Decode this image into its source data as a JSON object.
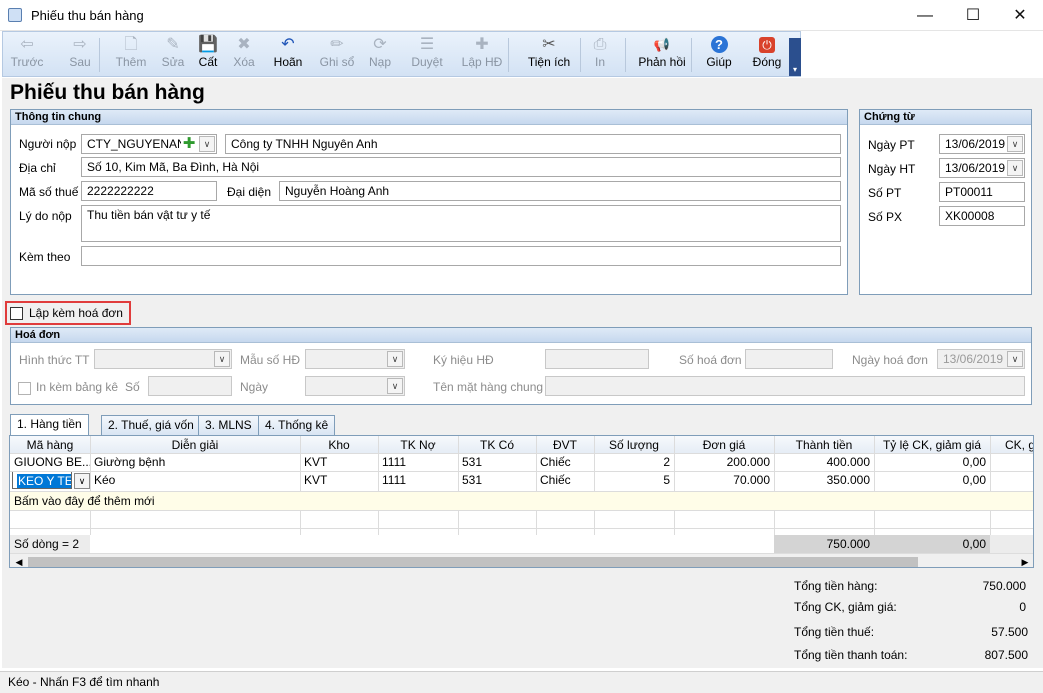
{
  "window": {
    "title": "Phiếu thu bán hàng"
  },
  "toolbar": {
    "items": [
      {
        "label": "Trước",
        "icon": "arrow-left-icon",
        "glyph": "⇦",
        "enabled": false
      },
      {
        "label": "Sau",
        "icon": "arrow-right-icon",
        "glyph": "⇨",
        "enabled": false
      },
      {
        "label": "Thêm",
        "icon": "add-doc-icon",
        "glyph": "🗋",
        "enabled": false
      },
      {
        "label": "Sửa",
        "icon": "edit-doc-icon",
        "glyph": "✎",
        "enabled": false
      },
      {
        "label": "Cất",
        "icon": "save-icon",
        "glyph": "💾",
        "enabled": true
      },
      {
        "label": "Xóa",
        "icon": "delete-doc-icon",
        "glyph": "✖",
        "enabled": false
      },
      {
        "label": "Hoãn",
        "icon": "undo-icon",
        "glyph": "↶",
        "enabled": true
      },
      {
        "label": "Ghi sổ",
        "icon": "pencil-icon",
        "glyph": "✏",
        "enabled": false
      },
      {
        "label": "Nạp",
        "icon": "reload-icon",
        "glyph": "⟳",
        "enabled": false
      },
      {
        "label": "Duyệt",
        "icon": "approve-icon",
        "glyph": "☰",
        "enabled": false
      },
      {
        "label": "Lập HĐ",
        "icon": "invoice-icon",
        "glyph": "✚",
        "enabled": false
      },
      {
        "label": "Tiện ích",
        "icon": "tools-icon",
        "glyph": "✂",
        "enabled": true
      },
      {
        "label": "In",
        "icon": "printer-icon",
        "glyph": "⎙",
        "enabled": false
      },
      {
        "label": "Phản hồi",
        "icon": "megaphone-icon",
        "glyph": "📢",
        "enabled": true
      },
      {
        "label": "Giúp",
        "icon": "help-icon",
        "glyph": "?",
        "enabled": true
      },
      {
        "label": "Đóng",
        "icon": "power-icon",
        "glyph": "⏻",
        "enabled": true
      }
    ]
  },
  "page_title": "Phiếu thu bán hàng",
  "general": {
    "header": "Thông tin chung",
    "payer_label": "Người nộp",
    "payer_code": "CTY_NGUYENAN",
    "payer_name": "Công ty TNHH Nguyên Anh",
    "address_label": "Địa chỉ",
    "address": "Số 10, Kim Mã, Ba Đình, Hà Nội",
    "tax_label": "Mã số thuế",
    "tax_code": "2222222222",
    "rep_label": "Đại diện",
    "rep": "Nguyễn Hoàng Anh",
    "reason_label": "Lý do nộp",
    "reason": "Thu tiền bán vật tư y tế",
    "attach_label": "Kèm theo",
    "attach": ""
  },
  "voucher": {
    "header": "Chứng từ",
    "post_date_label": "Ngày PT",
    "post_date": "13/06/2019",
    "doc_date_label": "Ngày HT",
    "doc_date": "13/06/2019",
    "receipt_no_label": "Số PT",
    "receipt_no": "PT00011",
    "export_no_label": "Số PX",
    "export_no": "XK00008"
  },
  "invoice_check": {
    "label": "Lập kèm hoá đơn",
    "checked": false
  },
  "invoice": {
    "header": "Hoá đơn",
    "form_label": "Hình thức TT",
    "template_label": "Mẫu số HĐ",
    "symbol_label": "Ký hiệu HĐ",
    "number_label": "Số hoá đơn",
    "date_label": "Ngày hoá đơn",
    "date": "13/06/2019",
    "print_list_label": "In kèm bảng kê",
    "no_label": "Số",
    "day_label": "Ngày",
    "common_name_label": "Tên mặt hàng chung"
  },
  "tabs": [
    "1. Hàng tiền",
    "2. Thuế, giá vốn",
    "3. MLNS",
    "4. Thống kê"
  ],
  "grid": {
    "columns": [
      "Mã hàng",
      "Diễn giải",
      "Kho",
      "TK Nợ",
      "TK Có",
      "ĐVT",
      "Số lượng",
      "Đơn giá",
      "Thành tiền",
      "Tỷ lệ CK, giảm giá",
      "CK, g"
    ],
    "rows": [
      [
        "GIUONG BE...",
        "Giường bệnh",
        "KVT",
        "1111",
        "531",
        "Chiếc",
        "2",
        "200.000",
        "400.000",
        "0,00"
      ],
      [
        "KEO Y TE",
        "Kéo",
        "KVT",
        "1111",
        "531",
        "Chiếc",
        "5",
        "70.000",
        "350.000",
        "0,00"
      ]
    ],
    "add_new": "Bấm vào đây để thêm mới",
    "row_count": "Số dòng = 2",
    "total_amount": "750.000",
    "total_discount_rate": "0,00"
  },
  "summary": {
    "goods_label": "Tổng tiền hàng:",
    "goods": "750.000",
    "discount_label": "Tổng CK, giảm giá:",
    "discount": "0",
    "tax_label": "Tổng tiền thuế:",
    "tax": "57.500",
    "pay_label": "Tổng tiền thanh toán:",
    "pay": "807.500"
  },
  "status": "Kéo - Nhấn F3 để tìm nhanh",
  "colors": {
    "highlight_box": "#e03c3c",
    "selected_cell": "#0078d7",
    "new_row": "#fffde8"
  }
}
